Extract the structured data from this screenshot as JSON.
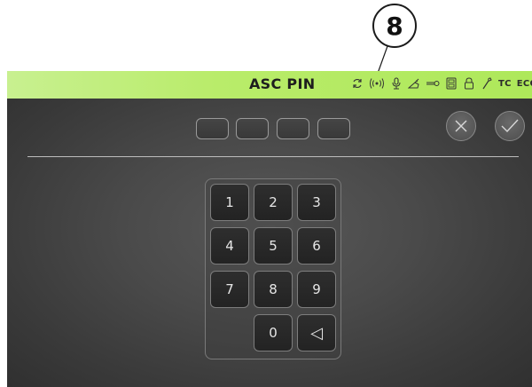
{
  "callout": {
    "number": "8"
  },
  "header": {
    "title": "ASC PIN",
    "status_icons": [
      "sync-icon",
      "wireless-icon",
      "microphone-icon",
      "spray-icon",
      "key-icon",
      "storage-icon",
      "lock-icon",
      "wrench-icon"
    ],
    "tc_label": "TC",
    "eco_label": "ECO"
  },
  "pin": {
    "digits": [
      "",
      "",
      "",
      ""
    ]
  },
  "actions": {
    "cancel_icon": "close-icon",
    "confirm_icon": "check-icon"
  },
  "keypad": {
    "keys": [
      "1",
      "2",
      "3",
      "4",
      "5",
      "6",
      "7",
      "8",
      "9",
      "0"
    ],
    "backspace_glyph": "◁"
  },
  "colors": {
    "header_green": "#b9ec6a",
    "panel_gray": "#4a4a4a"
  }
}
